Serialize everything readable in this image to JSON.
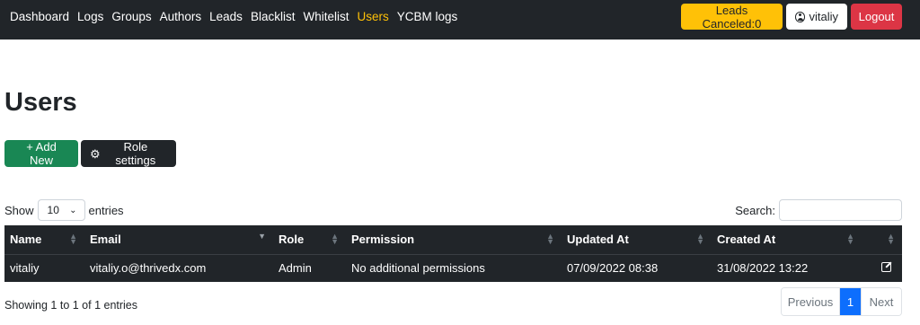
{
  "nav": {
    "links": [
      "Dashboard",
      "Logs",
      "Groups",
      "Authors",
      "Leads",
      "Blacklist",
      "Whitelist",
      "Users",
      "YCBM logs"
    ],
    "active": "Users",
    "leads_canceled": "Leads Canceled:0",
    "username": "vitaliy",
    "logout": "Logout",
    "icons": {
      "user": "user-circle-icon"
    }
  },
  "page": {
    "title": "Users",
    "add_new": "+ Add New",
    "role_settings": "Role settings",
    "icons": {
      "role_settings": "gear-icon"
    }
  },
  "controls": {
    "show_label": "Show",
    "entries_label": "entries",
    "length_value": "10",
    "search_label": "Search:",
    "search_value": ""
  },
  "table": {
    "columns": [
      "Name",
      "Email",
      "Role",
      "Permission",
      "Updated At",
      "Created At",
      ""
    ],
    "rows": [
      {
        "name": "vitaliy",
        "email": "vitaliy.o@thrivedx.com",
        "role": "Admin",
        "permission": "No additional permissions",
        "updated_at": "07/09/2022 08:38",
        "created_at": "31/08/2022 13:22",
        "action_icon": "edit-icon"
      }
    ]
  },
  "footer": {
    "info": "Showing 1 to 1 of 1 entries",
    "previous": "Previous",
    "current_page": "1",
    "next": "Next"
  },
  "colors": {
    "navbar": "#212529",
    "active_link": "#ffc107",
    "warning": "#ffc107",
    "danger": "#dc3545",
    "success": "#198754",
    "primary": "#0d6efd"
  }
}
